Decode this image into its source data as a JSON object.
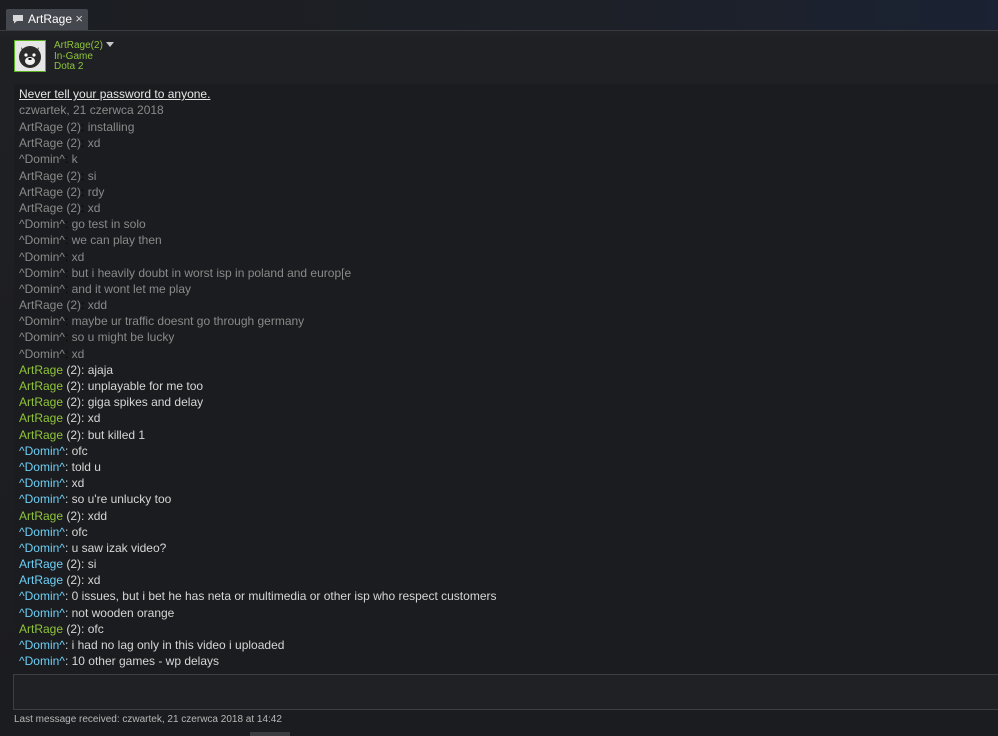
{
  "tab": {
    "label": "ArtRage",
    "close": "×",
    "icon": "chat-bubble-icon"
  },
  "friend": {
    "name": "ArtRage(2)",
    "status": "In-Game",
    "game": "Dota 2",
    "avatar_icon": "wolf-avatar-icon"
  },
  "chat": {
    "warning": "Never tell your password to anyone.",
    "date": "czwartek, 21 czerwca 2018",
    "messages": [
      {
        "who": "ArtRage (2)",
        "text": "installing",
        "type": "old"
      },
      {
        "who": "ArtRage (2)",
        "text": "xd",
        "type": "old"
      },
      {
        "who": "^Domin^",
        "text": "k",
        "type": "old"
      },
      {
        "who": "ArtRage (2)",
        "text": "si",
        "type": "old"
      },
      {
        "who": "ArtRage (2)",
        "text": "rdy",
        "type": "old"
      },
      {
        "who": "ArtRage (2)",
        "text": "xd",
        "type": "old"
      },
      {
        "who": "^Domin^",
        "text": "go test in solo",
        "type": "old"
      },
      {
        "who": "^Domin^",
        "text": "we can play then",
        "type": "old"
      },
      {
        "who": "^Domin^",
        "text": "xd",
        "type": "old"
      },
      {
        "who": "^Domin^",
        "text": "but i heavily doubt in worst isp in poland and europ[e",
        "type": "old"
      },
      {
        "who": "^Domin^",
        "text": "and it wont let me play",
        "type": "old"
      },
      {
        "who": "ArtRage (2)",
        "text": "xdd",
        "type": "old"
      },
      {
        "who": "^Domin^",
        "text": "maybe ur traffic doesnt go through germany",
        "type": "old"
      },
      {
        "who": "^Domin^",
        "text": "so u might be lucky",
        "type": "old"
      },
      {
        "who": "^Domin^",
        "text": "xd",
        "type": "old"
      },
      {
        "who": "ArtRage",
        "who2": " (2)",
        "text": "ajaja",
        "type": "them"
      },
      {
        "who": "ArtRage",
        "who2": " (2)",
        "text": "unplayable for me too",
        "type": "them"
      },
      {
        "who": "ArtRage",
        "who2": " (2)",
        "text": "giga spikes and delay",
        "type": "them"
      },
      {
        "who": "ArtRage",
        "who2": " (2)",
        "text": "xd",
        "type": "them"
      },
      {
        "who": "ArtRage",
        "who2": " (2)",
        "text": "but killed 1",
        "type": "them"
      },
      {
        "who": "^Domin^",
        "text": "ofc",
        "type": "me"
      },
      {
        "who": "^Domin^",
        "text": "told u",
        "type": "me"
      },
      {
        "who": "^Domin^",
        "text": "xd",
        "type": "me"
      },
      {
        "who": "^Domin^",
        "text": "so u're unlucky too",
        "type": "me"
      },
      {
        "who": "ArtRage",
        "who2": " (2)",
        "text": "xdd",
        "type": "them"
      },
      {
        "who": "^Domin^",
        "text": "ofc",
        "type": "me"
      },
      {
        "who": "^Domin^",
        "text": "u saw izak video?",
        "type": "me"
      },
      {
        "who": "ArtRage",
        "who2": " (2)",
        "text": "si",
        "type": "me2"
      },
      {
        "who": "ArtRage",
        "who2": " (2)",
        "text": "xd",
        "type": "me2"
      },
      {
        "who": "^Domin^",
        "text": "0 issues, but i bet he has neta or multimedia or other isp who respect customers",
        "type": "me"
      },
      {
        "who": "^Domin^",
        "text": "not wooden orange",
        "type": "me"
      },
      {
        "who": "ArtRage",
        "who2": " (2)",
        "text": "ofc",
        "type": "them"
      },
      {
        "who": "^Domin^",
        "text": "i had no lag only in this video i uploaded",
        "type": "me"
      },
      {
        "who": "^Domin^",
        "text": "10 other games - wp delays",
        "type": "me"
      }
    ]
  },
  "footer": {
    "last_received": "Last message received: czwartek, 21 czerwca 2018 at 14:42"
  },
  "colors": {
    "friend_green": "#8fc43a",
    "self_blue": "#6dcff6",
    "old_gray": "#8a8a8a"
  }
}
